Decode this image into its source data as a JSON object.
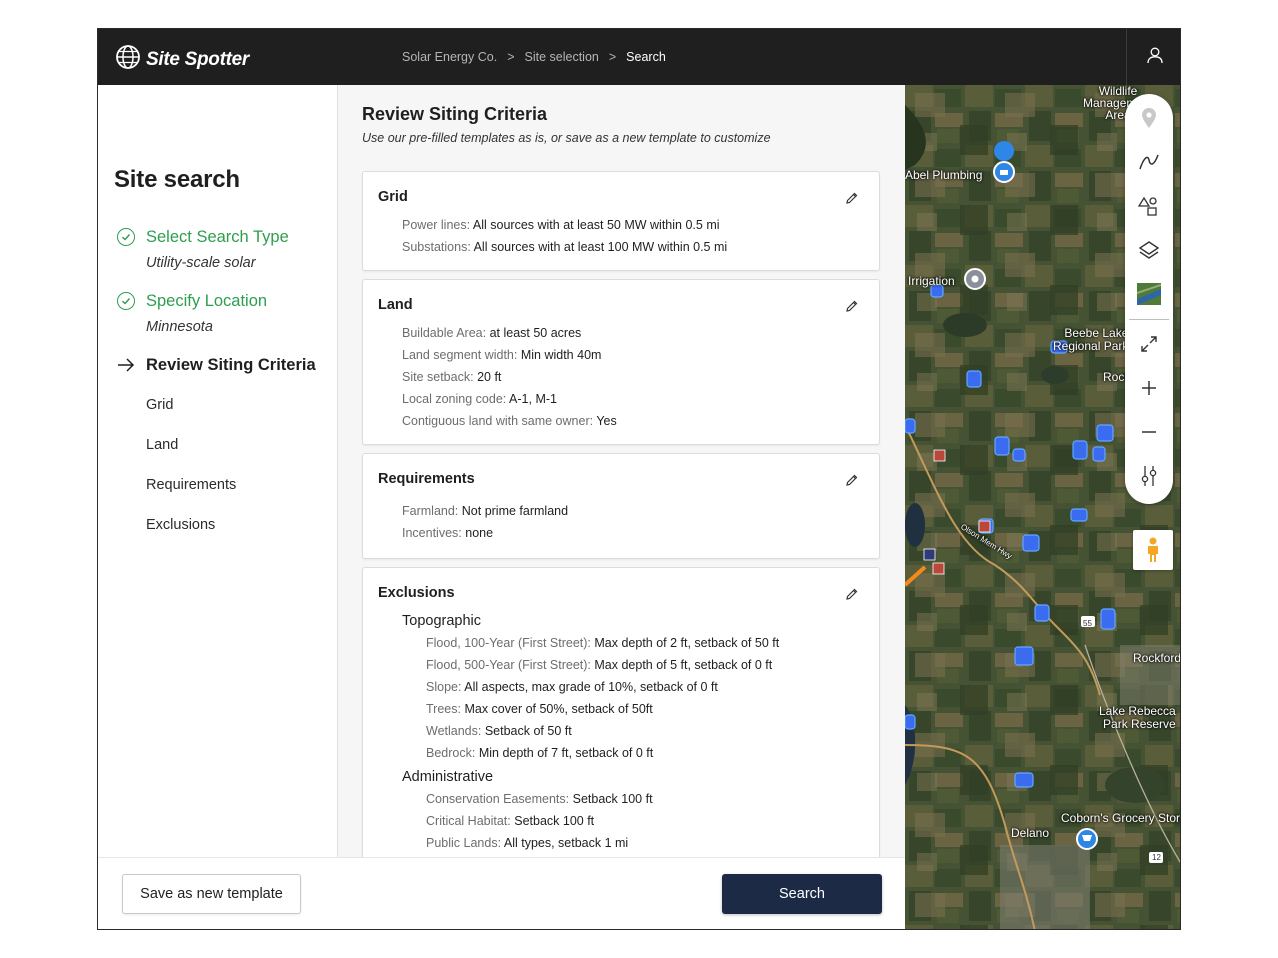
{
  "app": {
    "name": "Site Spotter",
    "logo_icon": "globe-icon"
  },
  "breadcrumb": [
    {
      "label": "Solar Energy Co."
    },
    {
      "label": ">"
    },
    {
      "label": "Site selection"
    },
    {
      "label": ">"
    },
    {
      "label": "Search"
    }
  ],
  "sidebar": {
    "title": "Site search",
    "steps": [
      {
        "label": "Select Search Type",
        "value": "Utility-scale solar",
        "status": "done"
      },
      {
        "label": "Specify Location",
        "value": "Minnesota",
        "status": "done"
      },
      {
        "label": "Review Siting Criteria",
        "status": "active"
      }
    ],
    "substeps": [
      "Grid",
      "Land",
      "Requirements",
      "Exclusions"
    ]
  },
  "main": {
    "title": "Review Siting Criteria",
    "subtitle": "Use our pre-filled templates as is, or save as a new template to customize",
    "cards": {
      "grid": {
        "title": "Grid",
        "rows": [
          {
            "k": "Power lines:",
            "v": "All sources with at least 50 MW within 0.5 mi"
          },
          {
            "k": "Substations:",
            "v": "All sources with at least 100 MW within 0.5 mi"
          }
        ]
      },
      "land": {
        "title": "Land",
        "rows": [
          {
            "k": "Buildable Area:",
            "v": "at least 50 acres"
          },
          {
            "k": "Land segment width:",
            "v": "Min width 40m"
          },
          {
            "k": "Site setback:",
            "v": "20 ft"
          },
          {
            "k": "Local zoning code:",
            "v": "A-1, M-1"
          },
          {
            "k": "Contiguous land with same owner:",
            "v": "Yes"
          }
        ]
      },
      "requirements": {
        "title": "Requirements",
        "rows": [
          {
            "k": "Farmland:",
            "v": "Not prime farmland"
          },
          {
            "k": "Incentives:",
            "v": "none"
          }
        ]
      },
      "exclusions": {
        "title": "Exclusions",
        "topographic": {
          "title": "Topographic",
          "rows": [
            {
              "k": "Flood, 100-Year (First Street):",
              "v": "Max depth of 2 ft, setback of 50 ft"
            },
            {
              "k": "Flood, 500-Year (First Street):",
              "v": "Max depth of 5 ft, setback of 0 ft"
            },
            {
              "k": "Slope:",
              "v": "All aspects, max grade of 10%, setback of 0 ft"
            },
            {
              "k": "Trees:",
              "v": "Max cover of 50%, setback of 50ft"
            },
            {
              "k": "Wetlands:",
              "v": "Setback of 50 ft"
            },
            {
              "k": "Bedrock:",
              "v": "Min depth of 7 ft, setback of 0 ft"
            }
          ]
        },
        "administrative": {
          "title": "Administrative",
          "rows": [
            {
              "k": "Conservation Easements:",
              "v": "Setback 100 ft"
            },
            {
              "k": "Critical Habitat:",
              "v": "Setback 100 ft"
            },
            {
              "k": "Public Lands:",
              "v": "All types, setback 1 mi"
            }
          ]
        }
      }
    }
  },
  "footer": {
    "save_label": "Save as new template",
    "search_label": "Search"
  },
  "map": {
    "labels": {
      "wildlife": "Wildlife\nManagement\nArea",
      "abel": "Abel Plumbing",
      "irrigation": "Irrigation",
      "beebe": "Beebe Lake\nRegional Park",
      "rock": "Rock",
      "olson": "Olson Mem Hwy",
      "rockford": "Rockford",
      "lake_rebecca": "Lake Rebecca\nPark Reserve",
      "coborns": "Coborn's Grocery Store",
      "delano": "Delano",
      "hwy55": "55",
      "hwy12": "12"
    },
    "tools": [
      "pin-icon",
      "draw-line-icon",
      "shapes-icon",
      "layers-icon",
      "satellite-thumbnail",
      "fullscreen-icon",
      "zoom-in-icon",
      "zoom-out-icon",
      "filter-sliders-icon",
      "pegman-icon"
    ]
  },
  "colors": {
    "accent_green": "#2e9e4e",
    "primary_navy": "#1c2a45",
    "site_blue": "#3b6cf0",
    "topbar": "#1f1f1f"
  }
}
